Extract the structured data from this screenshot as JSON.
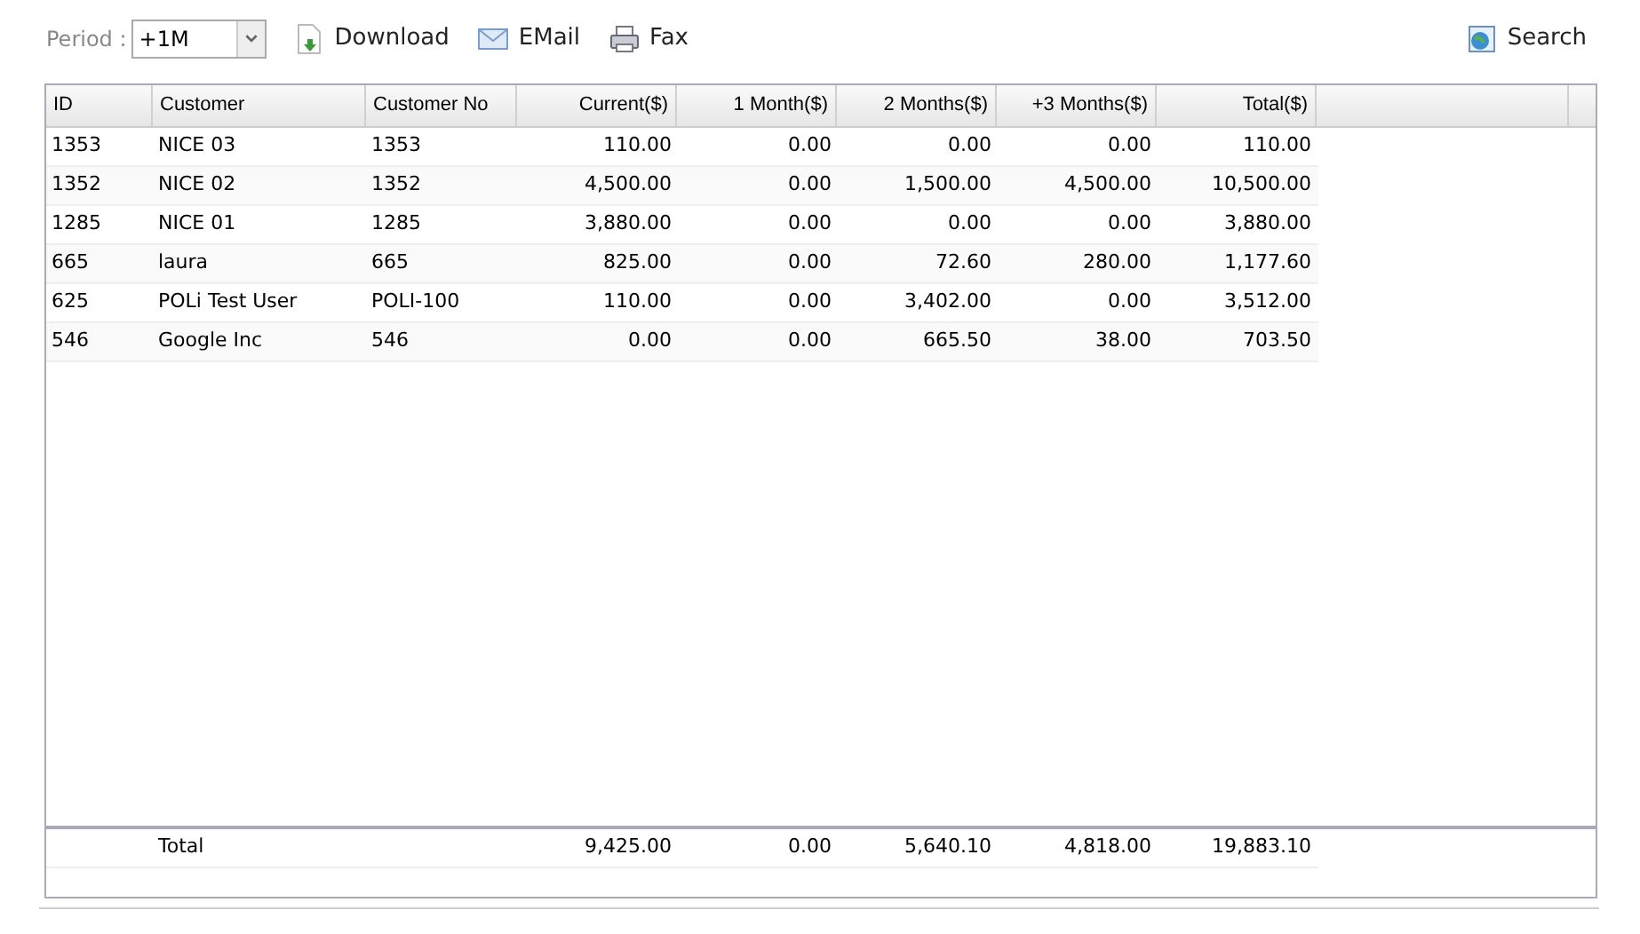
{
  "toolbar": {
    "period_label": "Period :",
    "period_value": "+1M",
    "actions": [
      {
        "kind": "download",
        "label": "Download"
      },
      {
        "kind": "email",
        "label": "EMail"
      },
      {
        "kind": "fax",
        "label": "Fax"
      }
    ],
    "search": "Search"
  },
  "table": {
    "columns": [
      "ID",
      "Customer",
      "Customer No",
      "Current($)",
      "1 Month($)",
      "2 Months($)",
      "+3 Months($)",
      "Total($)"
    ],
    "rows": [
      [
        "1353",
        "NICE 03",
        "1353",
        "110.00",
        "0.00",
        "0.00",
        "0.00",
        "110.00"
      ],
      [
        "1352",
        "NICE 02",
        "1352",
        "4,500.00",
        "0.00",
        "1,500.00",
        "4,500.00",
        "10,500.00"
      ],
      [
        "1285",
        "NICE 01",
        "1285",
        "3,880.00",
        "0.00",
        "0.00",
        "0.00",
        "3,880.00"
      ],
      [
        "665",
        "laura",
        "665",
        "825.00",
        "0.00",
        "72.60",
        "280.00",
        "1,177.60"
      ],
      [
        "625",
        "POLi Test User",
        "POLI-100",
        "110.00",
        "0.00",
        "3,402.00",
        "0.00",
        "3,512.00"
      ],
      [
        "546",
        "Google Inc",
        "546",
        "0.00",
        "0.00",
        "665.50",
        "38.00",
        "703.50"
      ]
    ],
    "footer": {
      "label": "Total",
      "values": [
        "9,425.00",
        "0.00",
        "5,640.10",
        "4,818.00",
        "19,883.10"
      ]
    }
  }
}
